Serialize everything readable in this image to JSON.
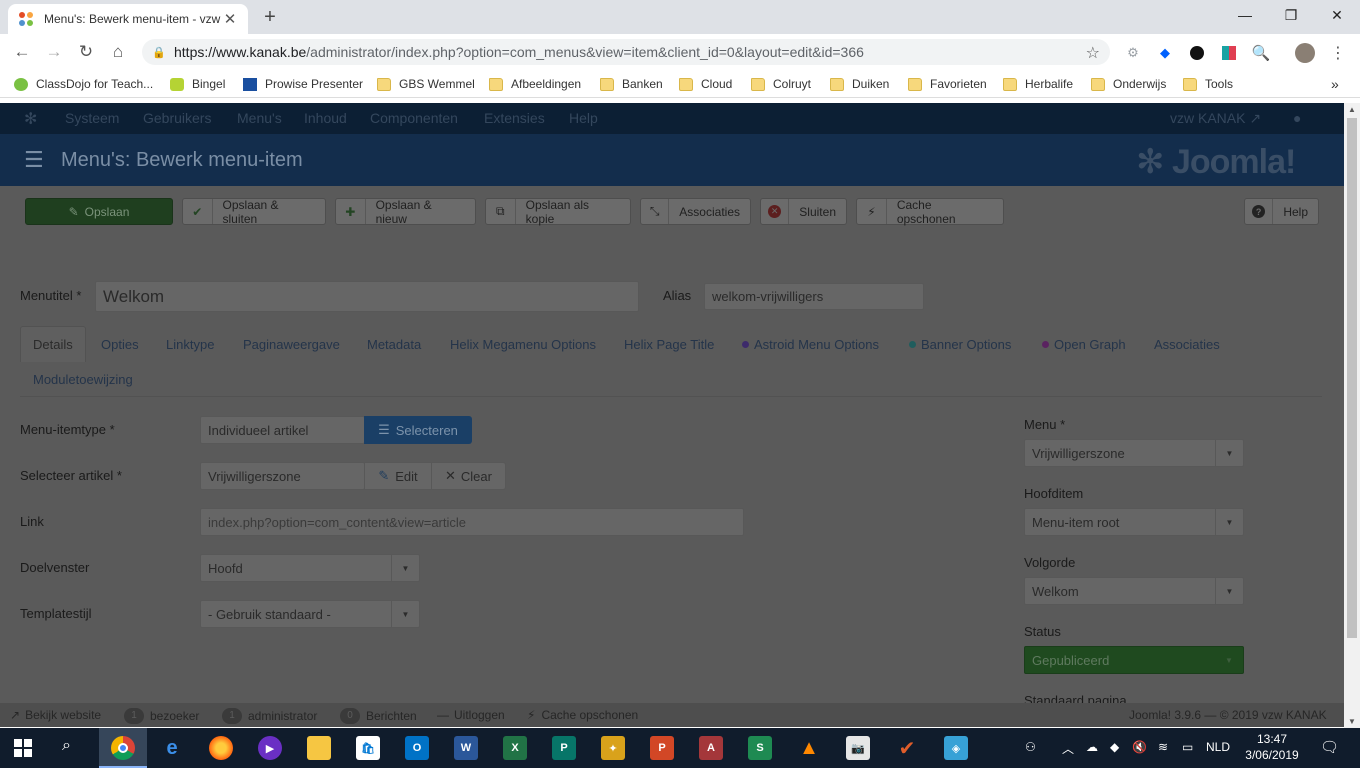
{
  "browser": {
    "tab_title": "Menu's: Bewerk menu-item - vzw",
    "url_host": "https://www.kanak.be",
    "url_path": "/administrator/index.php?option=com_menus&view=item&client_id=0&layout=edit&id=366",
    "bookmarks": [
      "ClassDojo for Teach...",
      "Bingel",
      "Prowise Presenter",
      "GBS Wemmel",
      "Afbeeldingen",
      "Banken",
      "Cloud",
      "Colruyt",
      "Duiken",
      "Favorieten",
      "Herbalife",
      "Onderwijs",
      "Tools"
    ],
    "more_bookmarks": "»"
  },
  "joomla": {
    "nav": [
      "Systeem",
      "Gebruikers",
      "Menu's",
      "Inhoud",
      "Componenten",
      "Extensies",
      "Help"
    ],
    "site_name": "vzw KANAK",
    "page_title": "Menu's: Bewerk menu-item",
    "logo_text": "Joomla!",
    "toolbar": {
      "save": "Opslaan",
      "save_close": "Opslaan & sluiten",
      "save_new": "Opslaan & nieuw",
      "save_copy": "Opslaan als kopie",
      "associations": "Associaties",
      "close": "Sluiten",
      "clear_cache": "Cache opschonen",
      "help": "Help"
    },
    "form": {
      "title_label": "Menutitel *",
      "title_value": "Welkom",
      "alias_label": "Alias",
      "alias_value": "welkom-vrijwilligers",
      "tabs": [
        "Details",
        "Opties",
        "Linktype",
        "Paginaweergave",
        "Metadata",
        "Helix Megamenu Options",
        "Helix Page Title",
        "Astroid Menu Options",
        "Banner Options",
        "Open Graph",
        "Associaties",
        "Moduletoewijzing"
      ],
      "menu_itemtype_label": "Menu-itemtype *",
      "menu_itemtype_value": "Individueel artikel",
      "select_button": "Selecteren",
      "select_article_label": "Selecteer artikel *",
      "select_article_value": "Vrijwilligerszone",
      "edit_button": "Edit",
      "clear_button": "Clear",
      "link_label": "Link",
      "link_value": "index.php?option=com_content&view=article",
      "target_label": "Doelvenster",
      "target_value": "Hoofd",
      "template_label": "Templatestijl",
      "template_value": "- Gebruik standaard -",
      "menu_label": "Menu *",
      "menu_value": "Vrijwilligerszone",
      "parent_label": "Hoofditem",
      "parent_value": "Menu-item root",
      "order_label": "Volgorde",
      "order_value": "Welkom",
      "status_label": "Status",
      "status_value": "Gepubliceerd",
      "default_page_label": "Standaard pagina"
    },
    "status_bar": {
      "view_site": "Bekijk website",
      "visitors_count": "1",
      "visitors": "bezoeker",
      "admins_count": "1",
      "admins": "administrator",
      "messages_count": "0",
      "messages": "Berichten",
      "logout": "Uitloggen",
      "clear_cache": "Cache opschonen",
      "version": "Joomla! 3.9.6 — © 2019 vzw KANAK"
    }
  },
  "taskbar": {
    "language": "NLD",
    "time": "13:47",
    "date": "3/06/2019"
  },
  "colors": {
    "joomla_nav": "#0c1f34",
    "joomla_header": "#132d4c",
    "overlay_gray": "#5a5a5a",
    "save_green": "#1f3f1f",
    "select_blue": "#1a3f66",
    "published_green": "#1f4a1f",
    "taskbar": "#101c2c"
  }
}
